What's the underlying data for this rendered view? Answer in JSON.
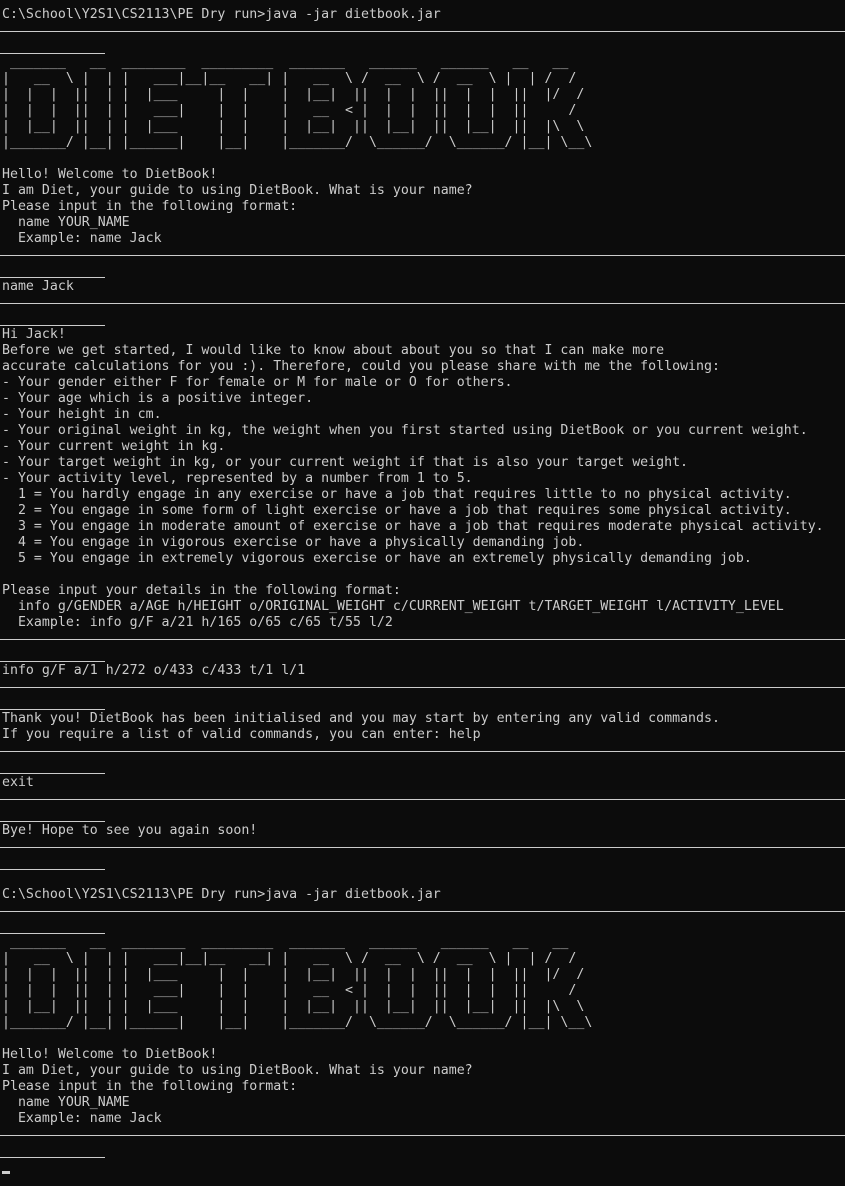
{
  "terminal": {
    "lines": [
      {
        "type": "text",
        "text": "C:\\School\\Y2S1\\CS2113\\PE Dry run>java -jar dietbook.jar"
      },
      {
        "type": "sep"
      },
      {
        "type": "under"
      },
      {
        "type": "ascii",
        "text": " _______   __  ________  _________  _______   ______   ______   __   __"
      },
      {
        "type": "ascii",
        "text": "|   __  \\ |  | |   ___|__|__   __| |   __  \\ /  __  \\ /  __  \\ |  | /  /"
      },
      {
        "type": "ascii",
        "text": "|  |  |  ||  | |  |___     |  |    |  |__|  ||  |  |  ||  |  |  ||  |/  /"
      },
      {
        "type": "ascii",
        "text": "|  |  |  ||  | |   ___|    |  |    |   __  < |  |  |  ||  |  |  ||     /"
      },
      {
        "type": "ascii",
        "text": "|  |__|  ||  | |  |___     |  |    |  |__|  ||  |__|  ||  |__|  ||  |\\  \\"
      },
      {
        "type": "ascii",
        "text": "|_______/ |__| |______|    |__|    |_______/  \\______/  \\______/ |__| \\__\\"
      },
      {
        "type": "blank"
      },
      {
        "type": "text",
        "text": "Hello! Welcome to DietBook!"
      },
      {
        "type": "text",
        "text": "I am Diet, your guide to using DietBook. What is your name?"
      },
      {
        "type": "text",
        "text": "Please input in the following format:"
      },
      {
        "type": "text",
        "text": "  name YOUR_NAME"
      },
      {
        "type": "text",
        "text": "  Example: name Jack"
      },
      {
        "type": "sep"
      },
      {
        "type": "under"
      },
      {
        "type": "text",
        "text": "name Jack"
      },
      {
        "type": "sep"
      },
      {
        "type": "under"
      },
      {
        "type": "text",
        "text": "Hi Jack!"
      },
      {
        "type": "text",
        "text": "Before we get started, I would like to know about about you so that I can make more"
      },
      {
        "type": "text",
        "text": "accurate calculations for you :). Therefore, could you please share with me the following:"
      },
      {
        "type": "text",
        "text": "- Your gender either F for female or M for male or O for others."
      },
      {
        "type": "text",
        "text": "- Your age which is a positive integer."
      },
      {
        "type": "text",
        "text": "- Your height in cm."
      },
      {
        "type": "text",
        "text": "- Your original weight in kg, the weight when you first started using DietBook or you current weight."
      },
      {
        "type": "text",
        "text": "- Your current weight in kg."
      },
      {
        "type": "text",
        "text": "- Your target weight in kg, or your current weight if that is also your target weight."
      },
      {
        "type": "text",
        "text": "- Your activity level, represented by a number from 1 to 5."
      },
      {
        "type": "text",
        "text": "  1 = You hardly engage in any exercise or have a job that requires little to no physical activity."
      },
      {
        "type": "text",
        "text": "  2 = You engage in some form of light exercise or have a job that requires some physical activity."
      },
      {
        "type": "text",
        "text": "  3 = You engage in moderate amount of exercise or have a job that requires moderate physical activity."
      },
      {
        "type": "text",
        "text": "  4 = You engage in vigorous exercise or have a physically demanding job."
      },
      {
        "type": "text",
        "text": "  5 = You engage in extremely vigorous exercise or have an extremely physically demanding job."
      },
      {
        "type": "blank"
      },
      {
        "type": "text",
        "text": "Please input your details in the following format:"
      },
      {
        "type": "text",
        "text": "  info g/GENDER a/AGE h/HEIGHT o/ORIGINAL_WEIGHT c/CURRENT_WEIGHT t/TARGET_WEIGHT l/ACTIVITY_LEVEL"
      },
      {
        "type": "text",
        "text": "  Example: info g/F a/21 h/165 o/65 c/65 t/55 l/2"
      },
      {
        "type": "sep"
      },
      {
        "type": "under"
      },
      {
        "type": "text",
        "text": "info g/F a/1 h/272 o/433 c/433 t/1 l/1"
      },
      {
        "type": "sep"
      },
      {
        "type": "under"
      },
      {
        "type": "text",
        "text": "Thank you! DietBook has been initialised and you may start by entering any valid commands."
      },
      {
        "type": "text",
        "text": "If you require a list of valid commands, you can enter: help"
      },
      {
        "type": "sep"
      },
      {
        "type": "under"
      },
      {
        "type": "text",
        "text": "exit"
      },
      {
        "type": "sep"
      },
      {
        "type": "under"
      },
      {
        "type": "text",
        "text": "Bye! Hope to see you again soon!"
      },
      {
        "type": "sep"
      },
      {
        "type": "under"
      },
      {
        "type": "blank"
      },
      {
        "type": "text",
        "text": "C:\\School\\Y2S1\\CS2113\\PE Dry run>java -jar dietbook.jar"
      },
      {
        "type": "sep"
      },
      {
        "type": "under"
      },
      {
        "type": "ascii",
        "text": " _______   __  ________  _________  _______   ______   ______   __   __"
      },
      {
        "type": "ascii",
        "text": "|   __  \\ |  | |   ___|__|__   __| |   __  \\ /  __  \\ /  __  \\ |  | /  /"
      },
      {
        "type": "ascii",
        "text": "|  |  |  ||  | |  |___     |  |    |  |__|  ||  |  |  ||  |  |  ||  |/  /"
      },
      {
        "type": "ascii",
        "text": "|  |  |  ||  | |   ___|    |  |    |   __  < |  |  |  ||  |  |  ||     /"
      },
      {
        "type": "ascii",
        "text": "|  |__|  ||  | |  |___     |  |    |  |__|  ||  |__|  ||  |__|  ||  |\\  \\"
      },
      {
        "type": "ascii",
        "text": "|_______/ |__| |______|    |__|    |_______/  \\______/  \\______/ |__| \\__\\"
      },
      {
        "type": "blank"
      },
      {
        "type": "text",
        "text": "Hello! Welcome to DietBook!"
      },
      {
        "type": "text",
        "text": "I am Diet, your guide to using DietBook. What is your name?"
      },
      {
        "type": "text",
        "text": "Please input in the following format:"
      },
      {
        "type": "text",
        "text": "  name YOUR_NAME"
      },
      {
        "type": "text",
        "text": "  Example: name Jack"
      },
      {
        "type": "sep"
      },
      {
        "type": "under"
      },
      {
        "type": "cursor"
      }
    ]
  }
}
